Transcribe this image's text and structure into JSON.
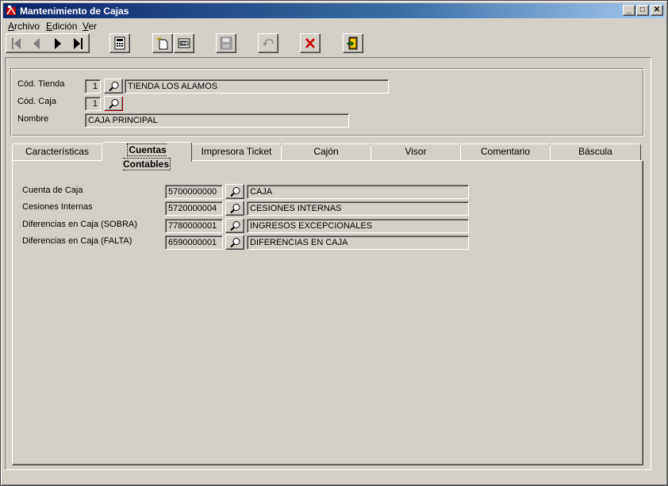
{
  "window": {
    "title": "Mantenimiento de Cajas",
    "controls": {
      "minimize": "_",
      "maximize": "□",
      "close": "✕"
    }
  },
  "menu": {
    "items": [
      {
        "label": "Archivo",
        "mnemonic": "A"
      },
      {
        "label": "Edición",
        "mnemonic": "E"
      },
      {
        "label": "Ver",
        "mnemonic": "V"
      }
    ]
  },
  "toolbar": {
    "icons": [
      "first-record-icon",
      "previous-record-icon",
      "next-record-icon",
      "last-record-icon",
      "calculator-icon",
      "new-record-icon",
      "edit-record-icon",
      "save-icon",
      "undo-icon",
      "delete-icon",
      "exit-icon"
    ],
    "accent_delete": "#cc0000"
  },
  "header": {
    "tienda": {
      "label": "Cód. Tienda",
      "code": "1",
      "name": "TIENDA LOS ALAMOS"
    },
    "caja": {
      "label": "Cód. Caja",
      "code": "1"
    },
    "nombre": {
      "label": "Nombre",
      "value": "CAJA PRINCIPAL"
    }
  },
  "tabs": [
    {
      "label": "Características"
    },
    {
      "label": "Cuentas Contables",
      "active": true
    },
    {
      "label": "Impresora Ticket"
    },
    {
      "label": "Cajón"
    },
    {
      "label": "Visor"
    },
    {
      "label": "Comentario"
    },
    {
      "label": "Báscula"
    }
  ],
  "cuentas": {
    "rows": [
      {
        "label": "Cuenta de Caja",
        "account": "5700000000",
        "description": "CAJA"
      },
      {
        "label": "Cesiones Internas",
        "account": "5720000004",
        "description": "CESIONES INTERNAS"
      },
      {
        "label": "Diferencias en Caja  (SOBRA)",
        "account": "7780000001",
        "description": "INGRESOS EXCEPCIONALES"
      },
      {
        "label": "Diferencias en Caja  (FALTA)",
        "account": "6590000001",
        "description": "DIFERENCIAS EN CAJA"
      }
    ]
  },
  "colors": {
    "titlebar_start": "#0a246a",
    "titlebar_end": "#a6caf0",
    "face": "#d4d0c8"
  }
}
